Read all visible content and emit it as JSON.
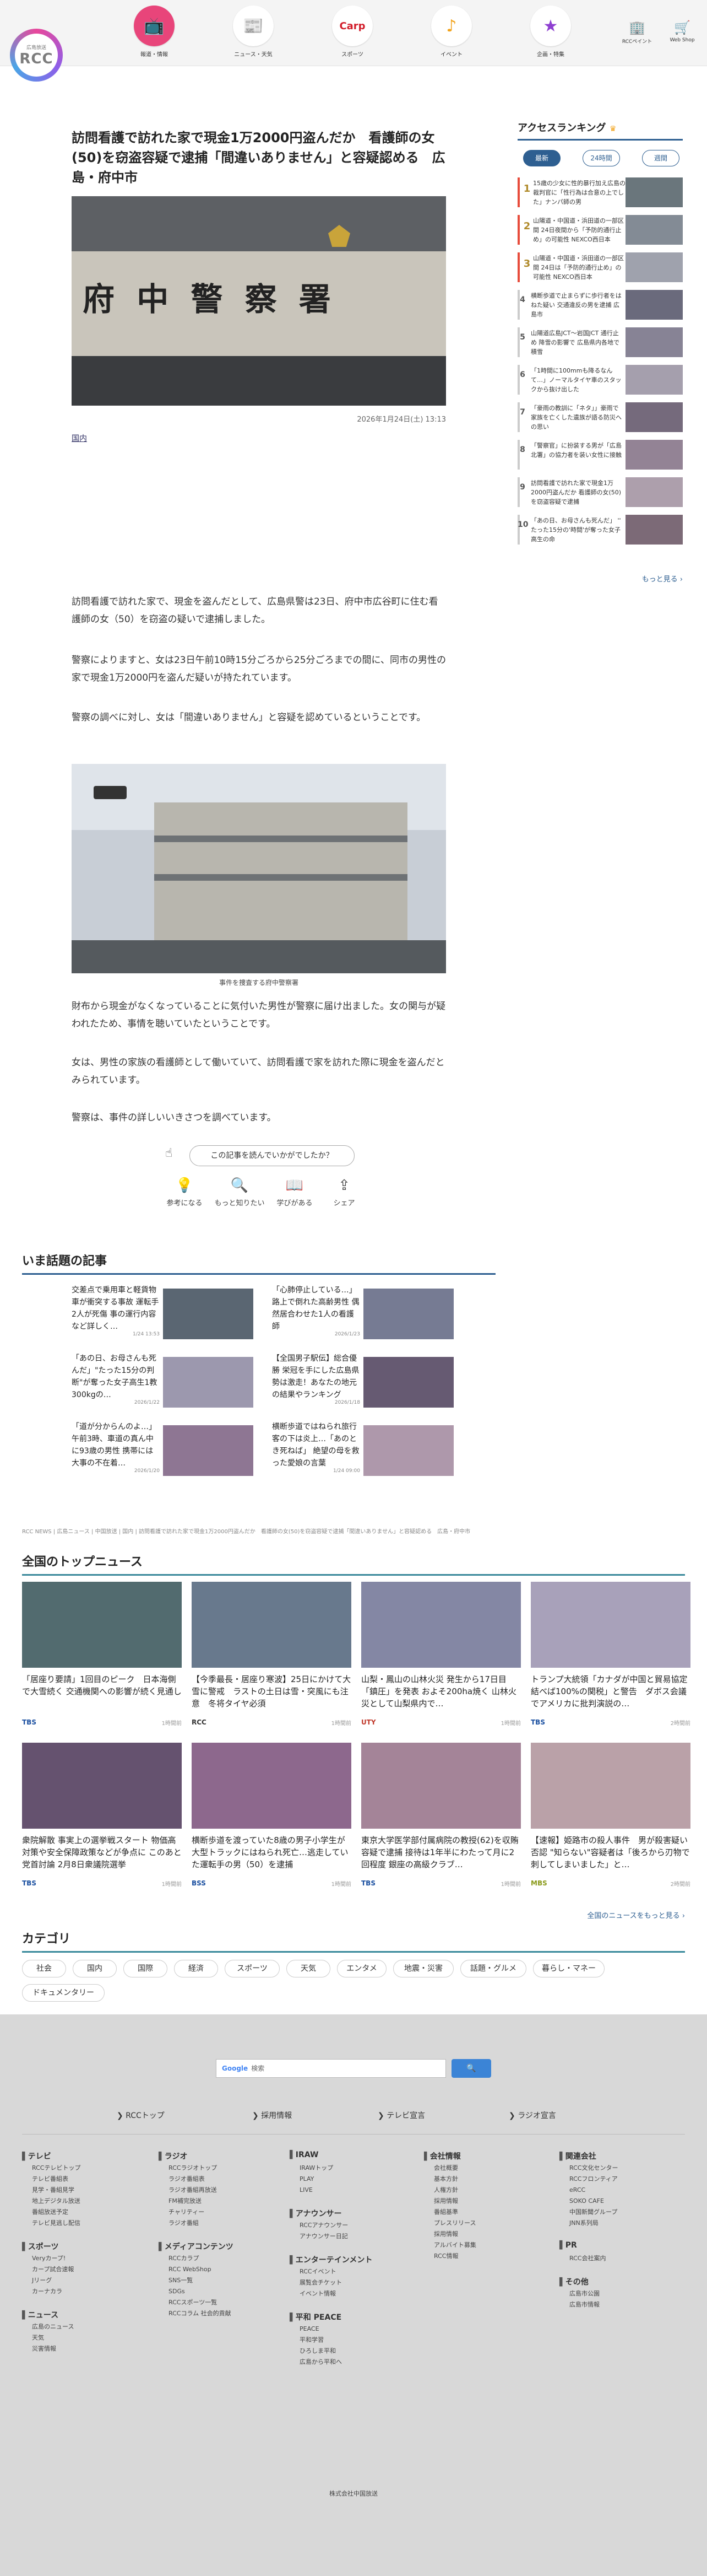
{
  "header": {
    "logo_sub": "広島放送",
    "logo_name": "RCC",
    "nav": [
      {
        "label": "報道・情報",
        "icon": "tv-icon",
        "color": "#e8457a"
      },
      {
        "label": "ニュース・天気",
        "icon": "news-icon",
        "color": "#4a8fd4"
      },
      {
        "label": "スポーツ",
        "icon": "carp-icon",
        "color": "#d21e2b"
      },
      {
        "label": "イベント",
        "icon": "music-icon",
        "color": "#f2a31b"
      },
      {
        "label": "企画・特集",
        "icon": "star-icon",
        "color": "#8e3fd1"
      }
    ],
    "links": [
      {
        "label": "RCCペイント",
        "icon": "building-icon"
      },
      {
        "label": "Web Shop",
        "icon": "cart-icon"
      }
    ]
  },
  "article": {
    "title": "訪問看護で訪れた家で現金1万2000円盗んだか　看護師の女(50)を窃盗容疑で逮捕「間違いありません」と容疑認める　広島・府中市",
    "sign_text": "府 中 警 察 署",
    "date": "2026年1月24日(土) 13:13",
    "category": "国内",
    "paragraphs": [
      "訪問看護で訪れた家で、現金を盗んだとして、広島県警は23日、府中市広谷町に住む看護師の女（50）を窃盗の疑いで逮捕しました。",
      "警察によりますと、女は23日午前10時15分ごろから25分ごろまでの間に、同市の男性の家で現金1万2000円を盗んだ疑いが持たれています。",
      "警察の調べに対し、女は「間違いありません」と容疑を認めているということです。"
    ],
    "photo_caption": "事件を捜査する府中警察署",
    "paragraphs_2": [
      "財布から現金がなくなっていることに気付いた男性が警察に届け出ました。女の関与が疑われたため、事情を聴いていたということです。",
      "女は、男性の家族の看護師として働いていて、訪問看護で家を訪れた際に現金を盗んだとみられています。",
      "警察は、事件の詳しいいきさつを調べています。"
    ],
    "feedback_question": "この記事を読んでいかがでしたか？",
    "reactions": [
      {
        "label": "参考になる",
        "icon": "bulb-icon"
      },
      {
        "label": "もっと知りたい",
        "icon": "search-icon"
      },
      {
        "label": "学びがある",
        "icon": "book-icon"
      },
      {
        "label": "シェア",
        "icon": "share-icon"
      }
    ]
  },
  "ranking": {
    "title": "アクセスランキング",
    "tabs": [
      "最新",
      "24時間",
      "週間"
    ],
    "items": [
      {
        "rank": "1",
        "text": "15歳の少女に性的暴行加え広島の裁判官に「性行為は合意の上でした」ナンパ師の男",
        "bar": "#e74c3c"
      },
      {
        "rank": "2",
        "text": "山陽道・中国道・浜田道の一部区間 24日夜間から「予防的通行止め」の可能性 NEXCO西日本",
        "bar": "#e74c3c"
      },
      {
        "rank": "3",
        "text": "山陽道・中国道・浜田道の一部区間 24日は「予防的通行止め」の可能性 NEXCO西日本",
        "bar": "#e74c3c"
      },
      {
        "rank": "4",
        "text": "横断歩道で止まらずに歩行者をはねた疑い 交通違反の男を逮捕 広島市",
        "bar": "#ccc"
      },
      {
        "rank": "5",
        "text": "山陽道広島JCT～岩国JCT 通行止め 降雪の影響で 広島県内各地で積雪",
        "bar": "#ccc"
      },
      {
        "rank": "6",
        "text": "「1時間に100mmも降るなんて…」ノーマルタイヤ車のスタックから抜け出した",
        "bar": "#ccc"
      },
      {
        "rank": "7",
        "text": "「豪雨の教訓に「ネタ」」豪雨で家族を亡くした遺族が語る防災への思い",
        "bar": "#ccc"
      },
      {
        "rank": "8",
        "text": "「警察官」に扮装する男が「広島北署」の協力者を装い女性に接触",
        "bar": "#ccc"
      },
      {
        "rank": "9",
        "text": "訪問看護で訪れた家で現金1万2000円盗んだか 看護師の女(50)を窃盗容疑で逮捕",
        "bar": "#ccc"
      },
      {
        "rank": "10",
        "text": "「あの日、お母さんも死んだ」 '' たった15分の'時間'が奪った女子高生の命",
        "bar": "#ccc"
      }
    ],
    "more": "もっと見る ›"
  },
  "trending": {
    "title": "いま話題の記事",
    "items": [
      {
        "text": "交差点で乗用車と軽貨物車が衝突する事故 運転手2人が死傷 事の運行内容など詳しく…",
        "date": "1/24 13:53"
      },
      {
        "text": "「心肺停止している…」路上で倒れた高齢男性 偶然居合わせた1人の看護師",
        "date": "2026/1/23"
      },
      {
        "text": "「あの日、お母さんも死んだ」\"たった15分の判断\"が奪った女子高生1教300kgの…",
        "date": "2026/1/22"
      },
      {
        "text": "【全国男子駅伝】総合優勝 栄冠を手にした広島県勢は激走！あなたの地元の結果やランキング",
        "date": "2026/1/18"
      },
      {
        "text": "「道が分からんのよ…」午前3時、車道の真ん中に93歳の男性 携帯には大事の不在着…",
        "date": "2026/1/20"
      },
      {
        "text": "横断歩道ではねられ旅行客の下は炎上…「あのとき死ねば」 絶望の母を救った愛娘の言葉",
        "date": "1/24 09:00"
      }
    ]
  },
  "breadcrumb": "RCC NEWS | 広島ニュース | 中国放送 | 国内 | 訪問看護で訪れた家で現金1万2000円盗んだか　看護師の女(50)を窃盗容疑で逮捕「間違いありません」と容疑認める　広島・府中市",
  "top_news": {
    "title": "全国のトップニュース",
    "items": [
      {
        "text": "「居座り要請」1回目のピーク　日本海側で大雪続く 交通機関への影響が続く見通し",
        "source": "TBS",
        "time": "1時間前",
        "color": "#1a4fa0"
      },
      {
        "text": "【今季最長・居座り寒波】25日にかけて大雪に警戒　ラストの土日は雪・突風にも注意　冬将タイヤ必須",
        "source": "RCC",
        "time": "1時間前",
        "color": "#333"
      },
      {
        "text": "山梨・鳳山の山林火災 発生から17日目「鎮圧」を発表 およそ200ha焼く 山林火災として山梨県内で…",
        "source": "UTY",
        "time": "1時間前",
        "color": "#c0392b"
      },
      {
        "text": "トランプ大統領「カナダが中国と貿易協定結べば100%の関税」と警告　ダボス会議でアメリカに批判演説の…",
        "source": "TBS",
        "time": "2時間前",
        "color": "#1a4fa0"
      },
      {
        "text": "衆院解散 事実上の選挙戦スタート 物価高対策や安全保障政策などが争点に このあと党首討論 2月8日衆議院選挙",
        "source": "TBS",
        "time": "1時間前",
        "color": "#1a4fa0"
      },
      {
        "text": "横断歩道を渡っていた8歳の男子小学生が大型トラックにはねられ死亡…逃走していた運転手の男（50）を逮捕",
        "source": "BSS",
        "time": "1時間前",
        "color": "#1a4fa0"
      },
      {
        "text": "東京大学医学部付属病院の教授(62)を収賄容疑で逮捕 接待は1年半にわたって月に2回程度 銀座の高級クラブ…",
        "source": "TBS",
        "time": "1時間前",
        "color": "#1a4fa0"
      },
      {
        "text": "【速報】姫路市の殺人事件　男が殺害疑い否認 \"知らない\"容疑者は「後ろから刃物で刺してしまいました」と…",
        "source": "MBS",
        "time": "2時間前",
        "color": "#8a9a1a"
      }
    ],
    "more": "全国のニュースをもっと見る ›"
  },
  "categories": {
    "title": "カテゴリ",
    "items": [
      "社会",
      "国内",
      "国際",
      "経済",
      "スポーツ",
      "天気",
      "エンタメ",
      "地震・災害",
      "話題・グルメ",
      "暮らし・マネー",
      "ドキュメンタリー"
    ]
  },
  "footer": {
    "search_brand": "Google",
    "search_hint": "検索",
    "search_button": "検索",
    "top_links": [
      "RCCトップ",
      "採用情報",
      "テレビ宣言",
      "ラジオ宣言"
    ],
    "columns": [
      {
        "heading": "テレビ",
        "items": [
          "RCCテレビトップ",
          "テレビ番組表",
          "見学・番組見学",
          "地上デジタル放送",
          "番組放送予定",
          "テレビ見逃し配信"
        ]
      },
      {
        "heading": "スポーツ",
        "items": [
          "Veryカープ!",
          "カープ試合速報",
          "Jリーグ",
          "カーナカラ"
        ]
      },
      {
        "heading": "ニュース",
        "items": [
          "広島のニュース",
          "天気",
          "災害情報"
        ]
      },
      {
        "heading": "ラジオ",
        "items": [
          "RCCラジオトップ",
          "ラジオ番組表",
          "ラジオ番組再放送",
          "FM補完放送",
          "チャリティー",
          "ラジオ番組"
        ]
      },
      {
        "heading": "メディアコンテンツ",
        "items": [
          "RCCカラプ",
          "RCC WebShop",
          "SNS一覧",
          "SDGs",
          "RCCスポーツ一覧",
          "RCCコラム 社会的貢献"
        ]
      },
      {
        "heading": "IRAW",
        "items": [
          "IRAWトップ",
          "PLAY",
          "LIVE"
        ]
      },
      {
        "heading": "アナウンサー",
        "items": [
          "RCCアナウンサー",
          "アナウンサー日記"
        ]
      },
      {
        "heading": "エンターテインメント",
        "items": [
          "RCCイベント",
          "展覧会チケット",
          "イベント情報"
        ]
      },
      {
        "heading": "平和 PEACE",
        "items": [
          "PEACE",
          "平和学習",
          "ひろしま平和",
          "広島から平和へ"
        ]
      },
      {
        "heading": "会社情報",
        "items": [
          "会社概要",
          "基本方針",
          "人権方針",
          "採用情報",
          "番組基準",
          "プレスリリース",
          "採用情報",
          "アルバイト募集",
          "RCC情報"
        ]
      },
      {
        "heading": "関連会社",
        "items": [
          "RCC文化センター",
          "RCCフロンティア",
          "eRCC",
          "SOKO CAFE",
          "中国新聞グループ",
          "JNN系列局"
        ]
      },
      {
        "heading": "PR",
        "items": [
          "RCC会社案内"
        ]
      },
      {
        "heading": "その他",
        "items": [
          "広島市公園",
          "広島市情報"
        ]
      }
    ],
    "copyright": "株式会社中国放送"
  }
}
